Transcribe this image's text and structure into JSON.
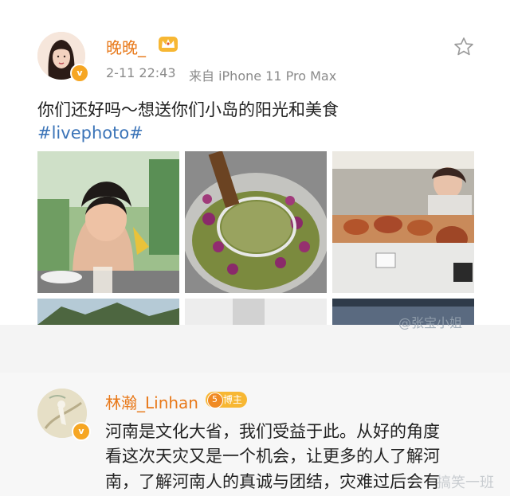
{
  "post": {
    "username": "晚晚_",
    "timestamp": "2-11 22:43",
    "source": "来自 iPhone 11 Pro Max",
    "text": "你们还好吗～想送你们小岛的阳光和美食",
    "hashtag": "#livephoto#",
    "favorite_icon": "star-outline-icon",
    "member_icon": "crown-icon",
    "verified_icon": "v-badge-icon",
    "photos": [
      {
        "name": "girl-eating-noodles"
      },
      {
        "name": "frying-taro-balls"
      },
      {
        "name": "fried-chicken-stall"
      }
    ],
    "watermark": "@张宝小姐"
  },
  "comment": {
    "username": "林瀚_Linhan",
    "badge_level": "5",
    "badge_label": "博主",
    "lines": [
      "河南是文化大省，我们受益于此。从好的角度",
      "看这次天灾又是一个机会，让更多的人了解河",
      "南，了解河南人的真诚与团结，灾难过后会有"
    ]
  },
  "corner_watermark": "搞笑一班"
}
